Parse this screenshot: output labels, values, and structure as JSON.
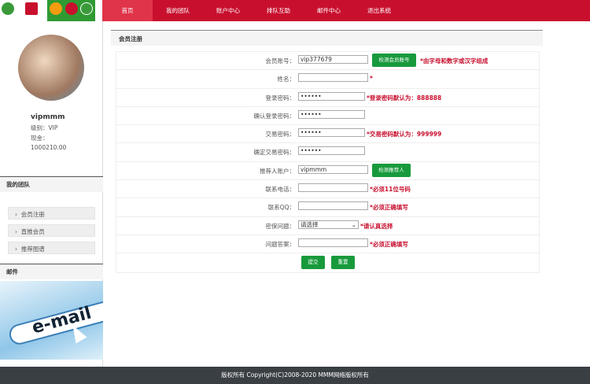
{
  "nav": [
    "首页",
    "我的团队",
    "账户中心",
    "排队互助",
    "邮件中心",
    "退出系统"
  ],
  "user": {
    "name": "vipmmm",
    "level": "级别：VIP",
    "cash_label": "现金：",
    "cash": "1000210.00"
  },
  "sidebar": {
    "team_title": "我的团队",
    "items": [
      "会员注册",
      "直推会员",
      "推荐图谱"
    ],
    "mail_title": "邮件",
    "email_banner": "e-mail"
  },
  "page_title": "会员注册",
  "form": {
    "account": {
      "label": "会员账号：",
      "value": "vip377679",
      "button": "检测会员账号",
      "note": "*由字母和数字或汉字组成"
    },
    "name": {
      "label": "姓名：",
      "value": "",
      "note": "*"
    },
    "login_pwd": {
      "label": "登录密码：",
      "value": "••••••",
      "note": "*登录密码默认为：888888"
    },
    "login_pwd2": {
      "label": "确认登录密码：",
      "value": "••••••"
    },
    "trade_pwd": {
      "label": "交易密码：",
      "value": "••••••",
      "note": "*交易密码默认为：999999"
    },
    "trade_pwd2": {
      "label": "确定交易密码：",
      "value": "••••••"
    },
    "referrer": {
      "label": "推荐人账户：",
      "value": "vipmmm",
      "button": "检测推荐人"
    },
    "phone": {
      "label": "联系电话：",
      "value": "",
      "note": "*必须11位号码"
    },
    "qq": {
      "label": "联系QQ：",
      "value": "",
      "note": "*必须正确填写"
    },
    "question": {
      "label": "密保问题：",
      "value": "请选择",
      "note": "*请认真选择"
    },
    "answer": {
      "label": "问题答案：",
      "value": "",
      "note": "*必须正确填写"
    },
    "submit": "提交",
    "reset": "重置"
  },
  "footer": "版权所有 Copyright(C)2008-2020 MMM网络版权所有"
}
